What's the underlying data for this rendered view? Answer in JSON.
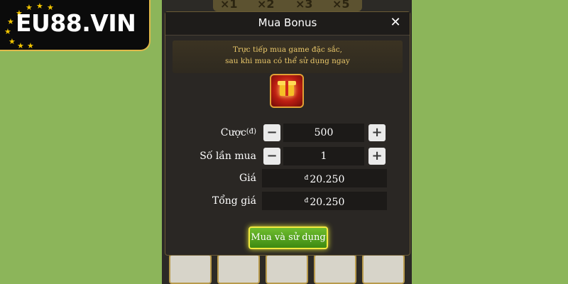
{
  "logo": {
    "text": "EU88.VIN"
  },
  "game_backdrop": {
    "multipliers": [
      "×1",
      "×2",
      "×3",
      "×5"
    ]
  },
  "dialog": {
    "title": "Mua Bonus",
    "close_label": "✕",
    "notice_lines": [
      "Trực tiếp mua game đặc sắc,",
      "sau khi mua có thể sử dụng ngay"
    ],
    "icon": "gift-box-icon",
    "rows": {
      "bet": {
        "label": "Cược",
        "currency_suffix": "(đ)",
        "value": "500"
      },
      "count": {
        "label": "Số lần mua",
        "value": "1"
      },
      "price": {
        "label": "Giá",
        "currency": "đ",
        "value": "20.250"
      },
      "total": {
        "label": "Tổng giá",
        "currency": "đ",
        "value": "20.250"
      }
    },
    "minus_label": "−",
    "plus_label": "+",
    "buy_button": "Mua và sử dụng"
  },
  "colors": {
    "background_green": "#8fb85c",
    "dialog_bg": "#2a2724",
    "notice_text": "#e9c76a",
    "buy_button_green": "#4d9a1b",
    "buy_button_glow": "#f2ea3f",
    "logo_star": "#f2c500"
  }
}
